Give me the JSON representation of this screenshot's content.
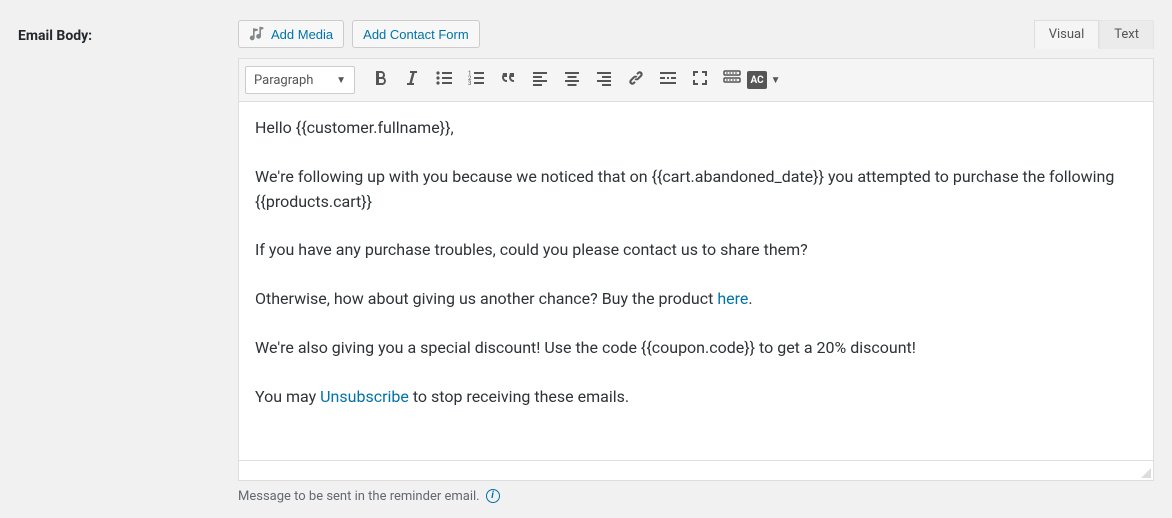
{
  "label": "Email Body:",
  "buttons": {
    "add_media": "Add Media",
    "add_contact_form": "Add Contact Form"
  },
  "tabs": {
    "visual": "Visual",
    "text": "Text"
  },
  "toolbar": {
    "format": "Paragraph",
    "ac_label": "AC"
  },
  "content": {
    "greeting": "Hello {{customer.fullname}},",
    "follow1": "We're following up with you because we noticed that on {{cart.abandoned_date}} you attempted to purchase the following {{products.cart}}",
    "trouble": "If you have any purchase troubles, could you please contact us to share them?",
    "chance_prefix": "Otherwise, how about giving us another chance? Buy the product ",
    "chance_link": "here",
    "chance_suffix": ".",
    "discount": "We're also giving you a special discount! Use the code {{coupon.code}} to get a 20% discount!",
    "unsub_prefix": "You may ",
    "unsub_link": "Unsubscribe",
    "unsub_suffix": " to stop receiving these emails."
  },
  "description": "Message to be sent in the reminder email."
}
